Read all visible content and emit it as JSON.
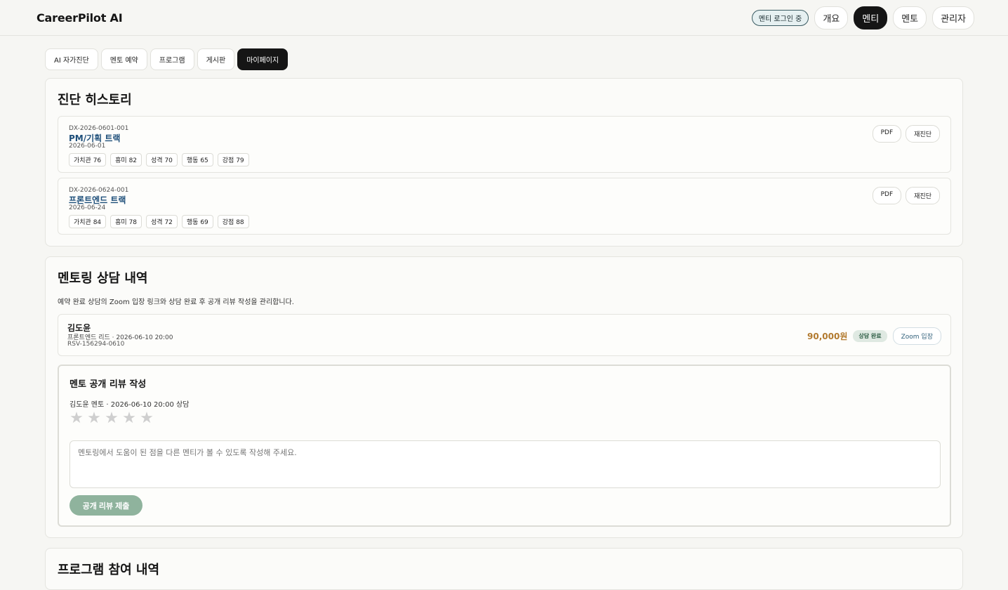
{
  "app": {
    "title": "CareerPilot AI"
  },
  "topnav": {
    "status": "멘티 로그인 중",
    "items": [
      "개요",
      "멘티",
      "멘토",
      "관리자"
    ],
    "active": "멘티"
  },
  "tabs": {
    "items": [
      "AI 자가진단",
      "멘토 예약",
      "프로그램",
      "게시판",
      "마이페이지"
    ],
    "active": "마이페이지"
  },
  "diagnosis_history": {
    "title": "진단 히스토리",
    "items": [
      {
        "code": "DX-2026-0601-001",
        "track": "PM/기획 트랙",
        "date": "2026-06-01",
        "scores": [
          "가치관 76",
          "흥미 82",
          "성격 70",
          "행동 65",
          "강점 79"
        ],
        "pdf": "PDF",
        "rediagnose": "재진단"
      },
      {
        "code": "DX-2026-0624-001",
        "track": "프론트엔드 트랙",
        "date": "2026-06-24",
        "scores": [
          "가치관 84",
          "흥미 78",
          "성격 72",
          "행동 69",
          "강점 88"
        ],
        "pdf": "PDF",
        "rediagnose": "재진단"
      }
    ]
  },
  "mentoring": {
    "title": "멘토링 상담 내역",
    "description": "예약 완료 상담의 Zoom 입장 링크와 상담 완료 후 공개 리뷰 작성을 관리합니다.",
    "reservation": {
      "mentor": "김도윤",
      "meta": "프론트엔드 리드 · 2026-06-10 20:00",
      "id": "RSV-156294-0610",
      "price": "90,000원",
      "status": "상담 완료",
      "zoom": "Zoom 입장"
    },
    "review": {
      "title": "멘토 공개 리뷰 작성",
      "subtitle": "김도윤 멘토 · 2026-06-10 20:00 상담",
      "rating": 0,
      "max_rating": 5,
      "placeholder": "멘토링에서 도움이 된 점을 다른 멘티가 볼 수 있도록 작성해 주세요.",
      "submit": "공개 리뷰 제출"
    }
  },
  "programs": {
    "title": "프로그램 참여 내역"
  },
  "colors": {
    "accent_dark": "#151515",
    "track_link": "#1e4f7a",
    "price": "#b27a2e",
    "submit_disabled": "#8fb39d"
  }
}
